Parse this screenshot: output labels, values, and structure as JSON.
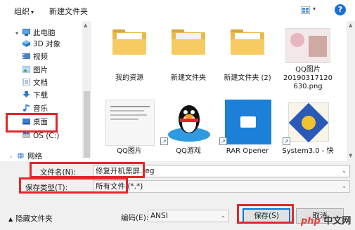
{
  "toolbar": {
    "organize_label": "组织",
    "new_folder_label": "新建文件夹",
    "help_label": "?"
  },
  "nav": {
    "items": [
      {
        "label": "此电脑",
        "icon": "computer-icon"
      },
      {
        "label": "3D 对象",
        "icon": "cube-icon"
      },
      {
        "label": "视频",
        "icon": "video-icon"
      },
      {
        "label": "图片",
        "icon": "picture-icon"
      },
      {
        "label": "文档",
        "icon": "document-icon"
      },
      {
        "label": "下载",
        "icon": "download-icon"
      },
      {
        "label": "音乐",
        "icon": "music-icon"
      },
      {
        "label": "桌面",
        "icon": "desktop-icon"
      },
      {
        "label": "OS (C:)",
        "icon": "drive-icon"
      },
      {
        "label": "网络",
        "icon": "network-icon"
      }
    ]
  },
  "files": [
    {
      "label": "我的资源",
      "type": "folder"
    },
    {
      "label": "新建文件夹",
      "type": "folder"
    },
    {
      "label": "新建文件夹 (2)",
      "type": "folder"
    },
    {
      "label": "QQ图片\n20190317120\n630.png",
      "type": "image"
    },
    {
      "label": "QQ图片",
      "type": "shortcut"
    },
    {
      "label": "QQ游戏",
      "type": "shortcut"
    },
    {
      "label": "RAR Opener",
      "type": "shortcut"
    },
    {
      "label": "System3.0 - 快",
      "type": "shortcut"
    }
  ],
  "form": {
    "filename_label": "文件名(N):",
    "filename_value": "修复开机黑屏.reg",
    "filetype_label": "保存类型(T):",
    "filetype_value": "所有文件 (*.*)",
    "hide_folders_label": "隐藏文件夹",
    "encoding_label": "编码(E):",
    "encoding_value": "ANSI",
    "save_label": "保存(S)",
    "cancel_label": "取消"
  },
  "watermark": {
    "text_php": "php",
    "text_rest": "中文网"
  },
  "colors": {
    "highlight": "#e2262b",
    "accent": "#0078d7",
    "folder": "#f6cb61"
  }
}
